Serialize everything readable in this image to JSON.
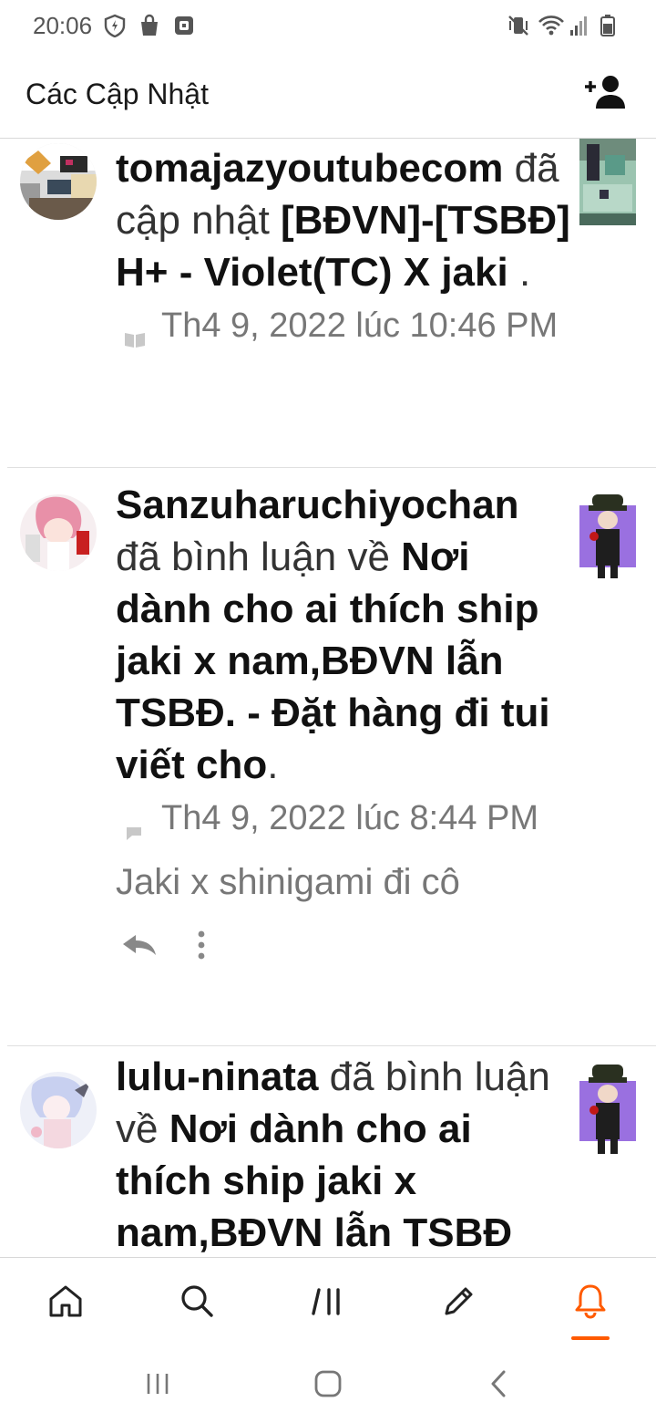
{
  "status_bar": {
    "time": "20:06",
    "left_icons": [
      "shield-icon",
      "shopping-bag-icon",
      "app-box-icon"
    ],
    "right_icons": [
      "mute-vibrate-icon",
      "wifi-icon",
      "signal-icon",
      "battery-icon"
    ]
  },
  "header": {
    "title": "Các Cập Nhật",
    "follow_icon": "add-person-icon"
  },
  "feed": [
    {
      "user": "tomajazyoutubecom",
      "action": " đã cập nhật ",
      "target": "[BĐVN]-[TSBĐ] H+ - Violet(TC) X jaki",
      "tail": " .",
      "meta_icon": "book-icon",
      "timestamp": "Th4 9, 2022 lúc 10:46 PM"
    },
    {
      "user": "Sanzuharuchiyochan",
      "action": " đã bình luận về ",
      "target": "Nơi dành cho ai thích ship jaki x nam,BĐVN lẫn TSBĐ. - Đặt hàng đi tui viết cho",
      "tail": ".",
      "meta_icon": "comment-icon",
      "timestamp": "Th4 9, 2022 lúc 8:44 PM",
      "excerpt": "Jaki x shinigami đi cô",
      "actions": [
        "reply-icon",
        "more-icon"
      ]
    },
    {
      "user": "lulu-ninata",
      "action": " đã bình luận về ",
      "target": "Nơi dành cho ai thích ship jaki x nam,BĐVN lẫn TSBĐ",
      "tail": ""
    }
  ],
  "bottom_nav": {
    "items": [
      "home-icon",
      "search-icon",
      "library-icon",
      "write-icon",
      "notifications-icon"
    ],
    "active": "notifications-icon",
    "accent": "#ff5a00"
  },
  "system_nav": [
    "recents-icon",
    "home-button-icon",
    "back-icon"
  ]
}
